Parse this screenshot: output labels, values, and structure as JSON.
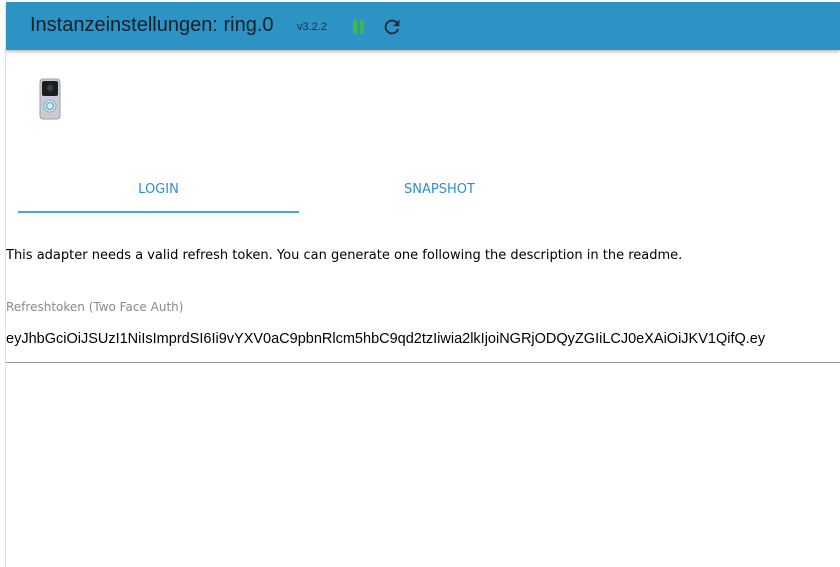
{
  "header": {
    "title": "Instanzeinstellungen: ring.0",
    "version": "v3.2.2",
    "pause_icon": "pause-icon",
    "reload_icon": "reload-icon",
    "colors": {
      "bar": "#2d92c4",
      "pause": "#3dbb4a"
    }
  },
  "logo": {
    "icon": "doorbell-logo"
  },
  "tabs": [
    {
      "label": "LOGIN",
      "active": true
    },
    {
      "label": "SNAPSHOT",
      "active": false
    }
  ],
  "colors": {
    "accent": "#2b8fd0"
  },
  "login": {
    "info": "This adapter needs a valid refresh token. You can generate one following the description in the readme.",
    "token_label": "Refreshtoken (Two Face Auth)",
    "token_value": "eyJhbGciOiJSUzI1NiIsImprdSI6Ii9vYXV0aC9pbnRlcm5hbC9qd2tzIiwia2lkIjoiNGRjODQyZGIiLCJ0eXAiOiJKV1QifQ.ey"
  }
}
